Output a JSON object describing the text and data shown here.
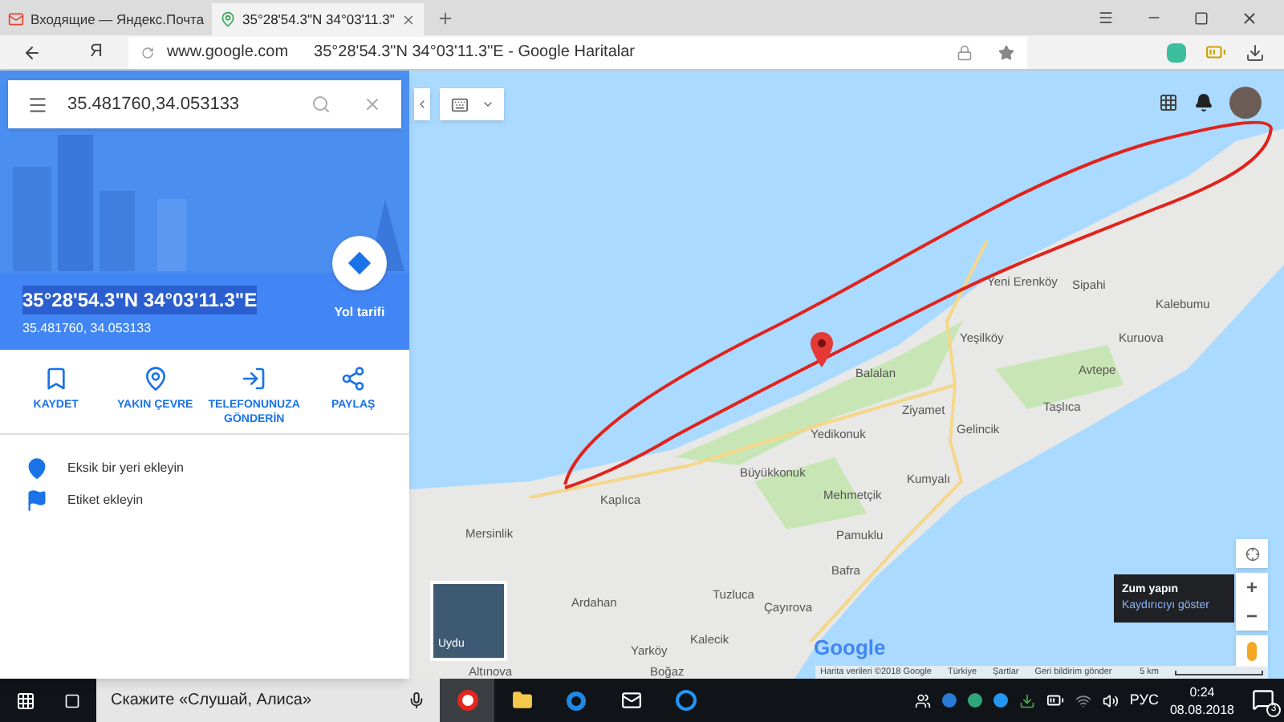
{
  "browser": {
    "tabs": [
      {
        "title": "Входящие — Яндекс.Почта",
        "selected": false
      },
      {
        "title": "35°28'54.3\"N 34°03'11.3\"",
        "selected": true
      }
    ],
    "address": {
      "domain": "www.google.com",
      "page_title": "35°28'54.3\"N 34°03'11.3\"E - Google Haritalar"
    },
    "yandex_button": "Я"
  },
  "panel": {
    "search": {
      "value": "35.481760,34.053133"
    },
    "title": "35°28'54.3\"N 34°03'11.3\"E",
    "subtitle": "35.481760, 34.053133",
    "directions": "Yol tarifi",
    "actions": [
      {
        "label": "KAYDET",
        "kind": "bookmark"
      },
      {
        "label": "YAKIN ÇEVRE",
        "kind": "nearby"
      },
      {
        "label": "TELEFONUNUZA GÖNDERİN",
        "kind": "phone"
      },
      {
        "label": "PAYLAŞ",
        "kind": "share"
      }
    ],
    "links": [
      {
        "label": "Eksik bir yeri ekleyin",
        "kind": "place"
      },
      {
        "label": "Etiket ekleyin",
        "kind": "flag"
      }
    ]
  },
  "map": {
    "places": [
      "Yeni Erenköy",
      "Sipahi",
      "Kalebumu",
      "Yeşilköy",
      "Kuruova",
      "Balalan",
      "Avtepe",
      "Ziyamet",
      "Taşlıca",
      "Yedikonuk",
      "Gelincik",
      "Büyükkonuk",
      "Kumyalı",
      "Mehmetçik",
      "Kaplıca",
      "Mersinlik",
      "Pamuklu",
      "Bafra",
      "Ardahan",
      "Tuzluca",
      "Çayırova",
      "Kalecik",
      "Yarköy",
      "Boğaz",
      "Altınova"
    ],
    "satellite_label": "Uydu",
    "logo": "Google",
    "tooltip": {
      "title": "Zum yapın",
      "link": "Kaydırıcıyı göster"
    },
    "zoom_in": "+",
    "zoom_out": "−",
    "footer": [
      "Harita verileri ©2018 Google",
      "Türkiye",
      "Şartlar",
      "Geri bildirim gönder"
    ],
    "scale": "5 km"
  },
  "taskbar": {
    "search_placeholder": "Скажите «Слушай, Алиса»",
    "language": "РУС",
    "time": "0:24",
    "date": "08.08.2018",
    "notifications": "3"
  }
}
